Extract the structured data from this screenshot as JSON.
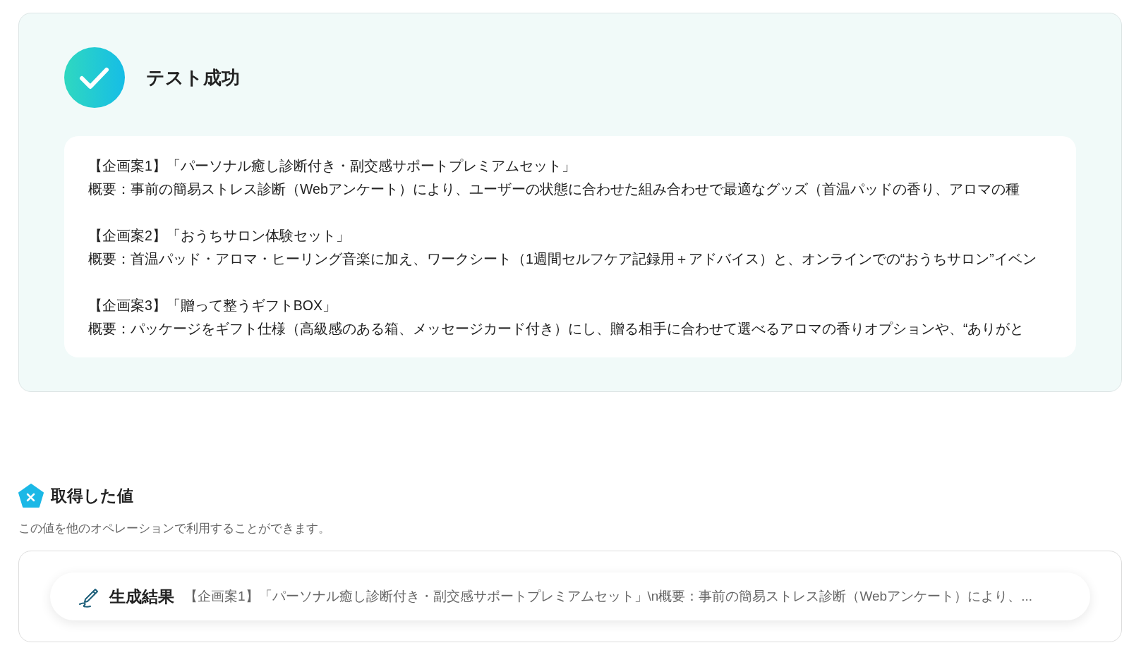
{
  "result": {
    "success": true,
    "title": "テスト成功",
    "output_lines": [
      {
        "kind": "heading",
        "text": "【企画案1】「パーソナル癒し診断付き・副交感サポートプレミアムセット」"
      },
      {
        "kind": "body",
        "text": "概要：事前の簡易ストレス診断（Webアンケート）により、ユーザーの状態に合わせた組み合わせで最適なグッズ（首温パッドの香り、アロマの種"
      },
      {
        "kind": "gap"
      },
      {
        "kind": "heading",
        "text": "【企画案2】「おうちサロン体験セット」"
      },
      {
        "kind": "body",
        "text": "概要：首温パッド・アロマ・ヒーリング音楽に加え、ワークシート（1週間セルフケア記録用＋アドバイス）と、オンラインでの“おうちサロン”イベン"
      },
      {
        "kind": "gap"
      },
      {
        "kind": "heading",
        "text": "【企画案3】「贈って整うギフトBOX」"
      },
      {
        "kind": "body",
        "text": "概要：パッケージをギフト仕様（高級感のある箱、メッセージカード付き）にし、贈る相手に合わせて選べるアロマの香りオプションや、“ありがと"
      }
    ]
  },
  "values": {
    "title": "取得した値",
    "description": "この値を他のオペレーションで利用することができます。",
    "items": [
      {
        "label": "生成結果",
        "value": "【企画案1】「パーソナル癒し診断付き・副交感サポートプレミアムセット」\\n概要：事前の簡易ストレス診断（Webアンケート）により、..."
      }
    ]
  }
}
